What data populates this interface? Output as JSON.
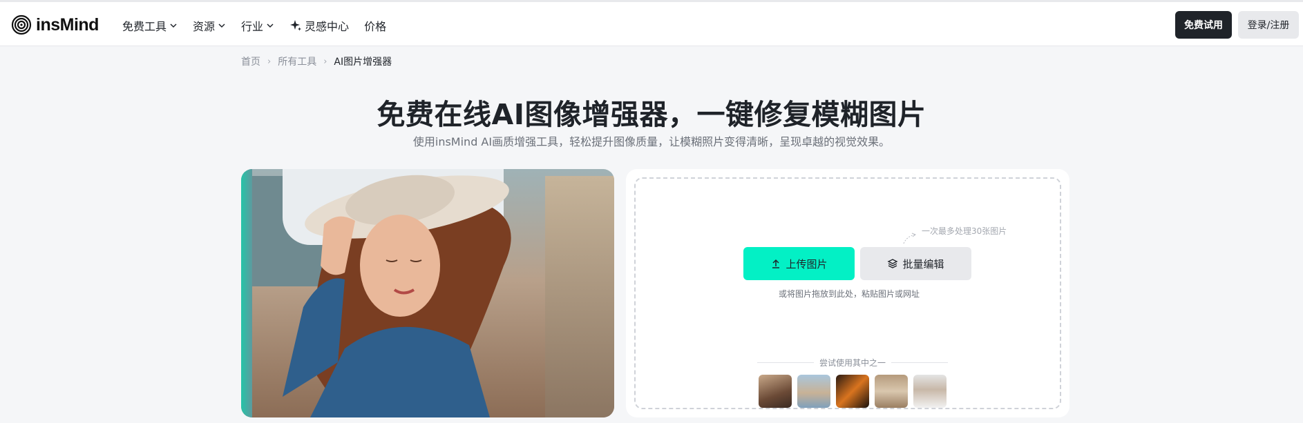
{
  "brand": {
    "name": "insMind"
  },
  "nav": {
    "items": [
      {
        "label": "免费工具",
        "has_dropdown": true
      },
      {
        "label": "资源",
        "has_dropdown": true
      },
      {
        "label": "行业",
        "has_dropdown": true
      },
      {
        "label": "灵感中心",
        "icon": "sparkle-icon",
        "has_dropdown": false
      },
      {
        "label": "价格",
        "has_dropdown": false
      }
    ],
    "trial_label": "免费试用",
    "login_label": "登录/注册"
  },
  "breadcrumb": [
    {
      "label": "首页"
    },
    {
      "label": "所有工具"
    },
    {
      "label": "AI图片增强器"
    }
  ],
  "hero": {
    "title": "免费在线AI图像增强器，一键修复模糊图片",
    "subtitle": "使用insMind AI画质增强工具，轻松提升图像质量，让模糊照片变得清晰，呈现卓越的视觉效果。"
  },
  "upload": {
    "note": "一次最多处理30张图片",
    "upload_label": "上传图片",
    "batch_label": "批量编辑",
    "drop_hint": "或将图片拖放到此处，粘贴图片或网址",
    "try_label": "尝试使用其中之一",
    "samples": [
      "woman-portrait",
      "mountain-lake",
      "sneaker",
      "vintage-portrait",
      "sunglasses-woman"
    ]
  },
  "colors": {
    "accent": "#03f0c5",
    "dark": "#1f2329",
    "bg": "#f5f6f8"
  }
}
